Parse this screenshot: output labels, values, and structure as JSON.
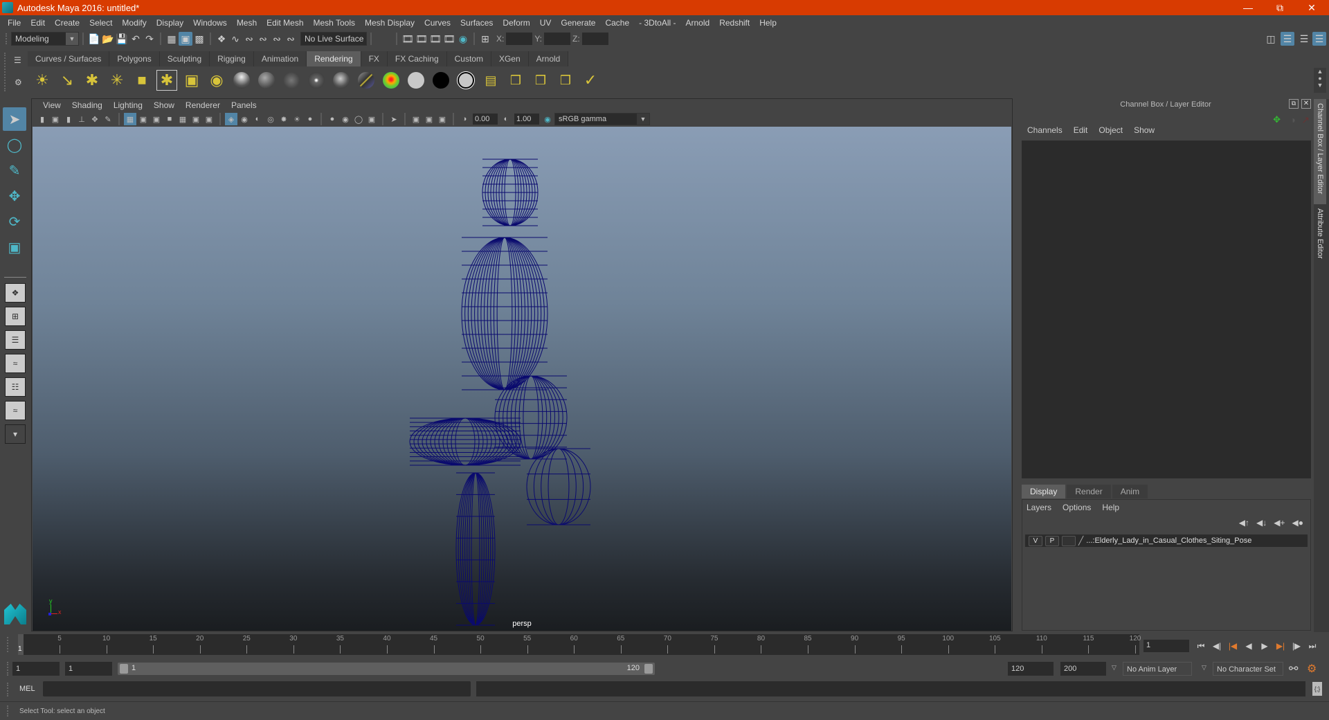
{
  "window": {
    "title": "Autodesk Maya 2016: untitled*",
    "controls": [
      "minimize",
      "restore",
      "close"
    ]
  },
  "menubar": [
    "File",
    "Edit",
    "Create",
    "Select",
    "Modify",
    "Display",
    "Windows",
    "Mesh",
    "Edit Mesh",
    "Mesh Tools",
    "Mesh Display",
    "Curves",
    "Surfaces",
    "Deform",
    "UV",
    "Generate",
    "Cache",
    "- 3DtoAll -",
    "Arnold",
    "Redshift",
    "Help"
  ],
  "statusline": {
    "menuset": "Modeling",
    "live_surface": "No Live Surface",
    "xyz_labels": [
      "X:",
      "Y:",
      "Z:"
    ]
  },
  "shelf": {
    "tabs": [
      "Curves / Surfaces",
      "Polygons",
      "Sculpting",
      "Rigging",
      "Animation",
      "Rendering",
      "FX",
      "FX Caching",
      "Custom",
      "XGen",
      "Arnold"
    ],
    "active_tab": "Rendering",
    "icons": [
      "ambient-light",
      "directional-light",
      "point-light",
      "spot-light",
      "area-light",
      "volume-light",
      "light-editor",
      "hypershade",
      "blinn-sphere",
      "lambert-sphere",
      "phong-sphere",
      "phongE-sphere",
      "anisotropic-sphere",
      "layered-shader",
      "ramp-shader",
      "surface-shader-white",
      "use-background-black",
      "surface-shader-outlined",
      "render-settings",
      "render-view",
      "ipr-render",
      "batch-render",
      "render-sequence"
    ]
  },
  "toolbox": {
    "tools": [
      "select-tool",
      "lasso-tool",
      "paint-select-tool",
      "move-tool",
      "rotate-tool",
      "scale-tool"
    ],
    "active_tool": "select-tool",
    "layouts": [
      "single-pane",
      "four-pane",
      "outliner-persp",
      "persp-graph",
      "hypershade-persp",
      "custom-layout",
      "more-layouts"
    ]
  },
  "viewport": {
    "menus": [
      "View",
      "Shading",
      "Lighting",
      "Show",
      "Renderer",
      "Panels"
    ],
    "exposure": "0.00",
    "gamma": "1.00",
    "color_space": "sRGB gamma",
    "camera_label": "persp",
    "axis": {
      "x": "x",
      "y": "y"
    },
    "wire_color": "#0a0a6e"
  },
  "channel_box": {
    "title": "Channel Box / Layer Editor",
    "menus": [
      "Channels",
      "Edit",
      "Object",
      "Show"
    ]
  },
  "layer_editor": {
    "tabs": [
      "Display",
      "Render",
      "Anim"
    ],
    "active_tab": "Display",
    "menus": [
      "Layers",
      "Options",
      "Help"
    ],
    "layers": [
      {
        "v": "V",
        "p": "P",
        "name": "...:Elderly_Lady_in_Casual_Clothes_Siting_Pose"
      }
    ]
  },
  "side_tabs": [
    "Channel Box / Layer Editor",
    "Attribute Editor"
  ],
  "timeslider": {
    "ticks": [
      5,
      10,
      15,
      20,
      25,
      30,
      35,
      40,
      45,
      50,
      55,
      60,
      65,
      70,
      75,
      80,
      85,
      90,
      95,
      100,
      105,
      110,
      115,
      120
    ],
    "min": 1,
    "max": 120,
    "current_frame": "1",
    "current_field": "1"
  },
  "range": {
    "start": "1",
    "anim_start": "1",
    "range_start_label": "1",
    "range_end_label": "120",
    "end": "120",
    "anim_end": "200",
    "anim_layer": "No Anim Layer",
    "character_set": "No Character Set"
  },
  "command_line": {
    "label": "MEL",
    "value": ""
  },
  "help_line": "Select Tool: select an object",
  "colors": {
    "title_bar": "#d83b01",
    "accent": "#5285a6",
    "playhead": "#e07a2e"
  }
}
